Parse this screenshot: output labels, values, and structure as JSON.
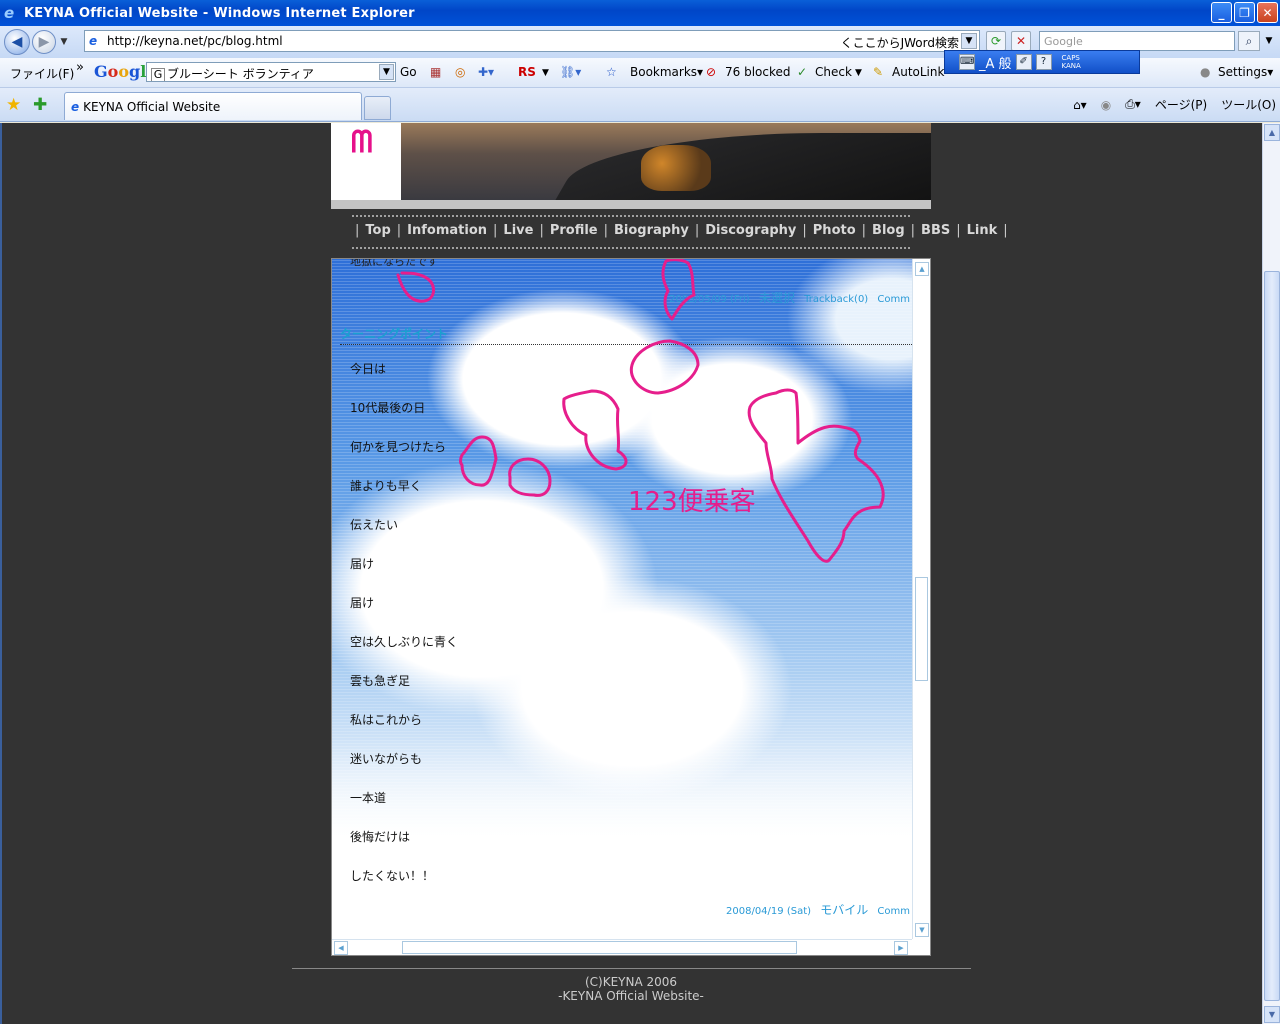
{
  "window": {
    "title": "KEYNA Official Website - Windows Internet Explorer",
    "buttons": [
      "_",
      "❐",
      "✕"
    ]
  },
  "address_bar": {
    "url": "http://keyna.net/pc/blog.html",
    "jword_hint": "くここからJWord検索",
    "search_placeholder": "Google"
  },
  "toolbar": {
    "menu_file": "ファイル(F)",
    "chevron": "»",
    "google_search_value": "ブルーシート ボランティア",
    "go": "Go",
    "rs": "RS",
    "bookmarks": "Bookmarks▾",
    "blocked": "76 blocked",
    "check": "Check",
    "autolink": "AutoLink",
    "settings": "Settings▾"
  },
  "ime_bar": {
    "mode": "_A 般",
    "caps": "CAPS",
    "kana": "KANA"
  },
  "tabs": {
    "active_tab": "KEYNA Official Website",
    "page_menu": "ページ(P)",
    "tools_menu": "ツール(O)"
  },
  "site": {
    "nav": [
      "Top",
      "Infomation",
      "Live",
      "Profile",
      "Biography",
      "Discography",
      "Photo",
      "Blog",
      "BBS",
      "Link"
    ],
    "previous_post_cut": "地獄にならたです",
    "previous_meta": {
      "date": "2008/05/09 (Fri)",
      "category": "未選択",
      "trackback": "Trackback(0)",
      "comment": "Comm"
    },
    "post": {
      "title": "ターニングポイント",
      "lines": [
        "今日は",
        "10代最後の日",
        "何かを見つけたら",
        "誰よりも早く",
        "伝えたい",
        "届け",
        "届け",
        "空は久しぶりに青く",
        "雲も急ぎ足",
        "私はこれから",
        "迷いながらも",
        "一本道",
        "後悔だけは",
        "したくない！！"
      ],
      "meta": {
        "date": "2008/04/19 (Sat)",
        "category": "モバイル",
        "comment": "Comm"
      }
    },
    "annotation": "123便乗客",
    "footer": [
      "(C)KEYNA 2006",
      "-KEYNA Official Website-"
    ]
  },
  "colors": {
    "annotation": "#e61e8c",
    "link_meta": "#2a9ad6",
    "page_bg": "#333333"
  }
}
